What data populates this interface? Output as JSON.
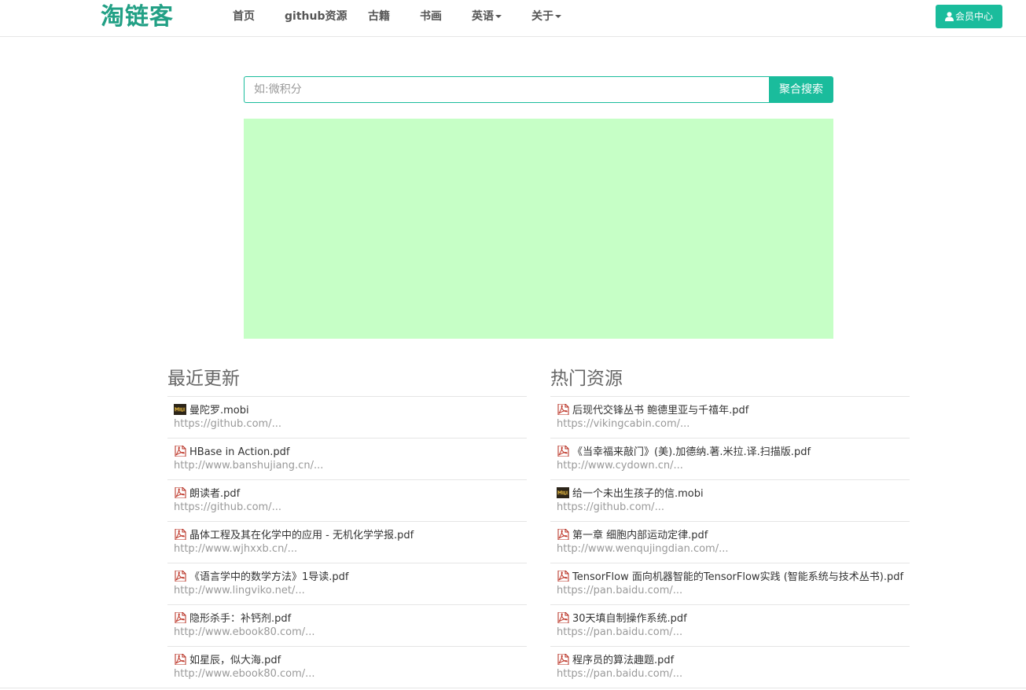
{
  "brand": {
    "logo_text": "淘链客",
    "accent": "#1abc9c",
    "ad_bg": "#c6ffc6"
  },
  "nav": {
    "items": [
      "首页",
      "github资源",
      "古籍",
      "书画",
      "英语",
      "关于"
    ],
    "member_label": "会员中心",
    "member_icon": "user-icon"
  },
  "search": {
    "placeholder": "如:微积分",
    "button_label": "聚合搜索"
  },
  "recent": {
    "heading": "最近更新",
    "items": [
      {
        "title": "曼陀罗.mobi",
        "url": "https://github.com/...",
        "icon": "mobi-icon"
      },
      {
        "title": "HBase in Action.pdf",
        "url": "http://www.banshujiang.cn/...",
        "icon": "pdf-icon"
      },
      {
        "title": "朗读者.pdf",
        "url": "https://github.com/...",
        "icon": "pdf-icon"
      },
      {
        "title": "晶体工程及其在化学中的应用 - 无机化学学报.pdf",
        "url": "http://www.wjhxxb.cn/...",
        "icon": "pdf-icon"
      },
      {
        "title": "《语言学中的数学方法》1导读.pdf",
        "url": "http://www.lingviko.net/...",
        "icon": "pdf-icon"
      },
      {
        "title": "隐形杀手：补钙剂.pdf",
        "url": "http://www.ebook80.com/...",
        "icon": "pdf-icon"
      },
      {
        "title": "如星辰，似大海.pdf",
        "url": "http://www.ebook80.com/...",
        "icon": "pdf-icon"
      }
    ]
  },
  "hot": {
    "heading": "热门资源",
    "items": [
      {
        "title": "后现代交锋丛书 鲍德里亚与千禧年.pdf",
        "url": "https://vikingcabin.com/...",
        "icon": "pdf-icon"
      },
      {
        "title": "《当幸福来敲门》(美).加德纳.著.米拉.译.扫描版.pdf",
        "url": "http://www.cydown.cn/...",
        "icon": "pdf-icon"
      },
      {
        "title": "给一个未出生孩子的信.mobi",
        "url": "https://github.com/...",
        "icon": "mobi-icon"
      },
      {
        "title": "第一章 细胞内部运动定律.pdf",
        "url": "http://www.wenqujingdian.com/...",
        "icon": "pdf-icon"
      },
      {
        "title": "TensorFlow 面向机器智能的TensorFlow实践 (智能系统与技术丛书).pdf",
        "url": "https://pan.baidu.com/...",
        "icon": "pdf-icon"
      },
      {
        "title": "30天填自制操作系统.pdf",
        "url": "https://pan.baidu.com/...",
        "icon": "pdf-icon"
      },
      {
        "title": "程序员的算法趣题.pdf",
        "url": "https://pan.baidu.com/...",
        "icon": "pdf-icon"
      }
    ]
  }
}
